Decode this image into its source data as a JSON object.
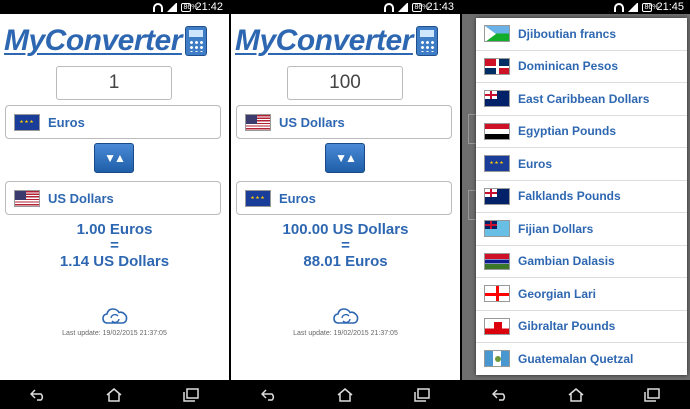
{
  "screens": [
    {
      "status_time": "21:42",
      "battery": "86%",
      "app_title": "MyConverter",
      "amount": "1",
      "from_currency": "Euros",
      "from_flag": "eu-flag",
      "to_currency": "US Dollars",
      "to_flag": "us-flag",
      "result_line1": "1.00 Euros",
      "result_eq": "=",
      "result_line2": "1.14 US Dollars",
      "last_update": "Last update: 19/02/2015 21:37:05"
    },
    {
      "status_time": "21:43",
      "battery": "86%",
      "app_title": "MyConverter",
      "amount": "100",
      "from_currency": "US Dollars",
      "from_flag": "us-flag",
      "to_currency": "Euros",
      "to_flag": "eu-flag",
      "result_line1": "100.00 US Dollars",
      "result_eq": "=",
      "result_line2": "88.01 Euros",
      "last_update": "Last update: 19/02/2015 21:37:05"
    },
    {
      "status_time": "21:45",
      "battery": "86%",
      "dropdown_items": [
        {
          "label": "Djiboutian francs",
          "flag": "dj"
        },
        {
          "label": "Dominican Pesos",
          "flag": "do"
        },
        {
          "label": "East Caribbean Dollars",
          "flag": "ec"
        },
        {
          "label": "Egyptian Pounds",
          "flag": "eg"
        },
        {
          "label": "Euros",
          "flag": "eu"
        },
        {
          "label": "Falklands Pounds",
          "flag": "fk"
        },
        {
          "label": "Fijian Dollars",
          "flag": "fj"
        },
        {
          "label": "Gambian Dalasis",
          "flag": "gm"
        },
        {
          "label": "Georgian Lari",
          "flag": "ge"
        },
        {
          "label": "Gibraltar Pounds",
          "flag": "gi"
        },
        {
          "label": "Guatemalan Quetzal",
          "flag": "gt"
        }
      ]
    }
  ],
  "icons": {
    "swap": "swap-arrows-icon",
    "refresh": "cloud-refresh-icon",
    "nav_back": "back-icon",
    "nav_home": "home-icon",
    "nav_recent": "recent-apps-icon"
  },
  "colors": {
    "accent": "#2e67b1",
    "button": "#2f73c0"
  }
}
